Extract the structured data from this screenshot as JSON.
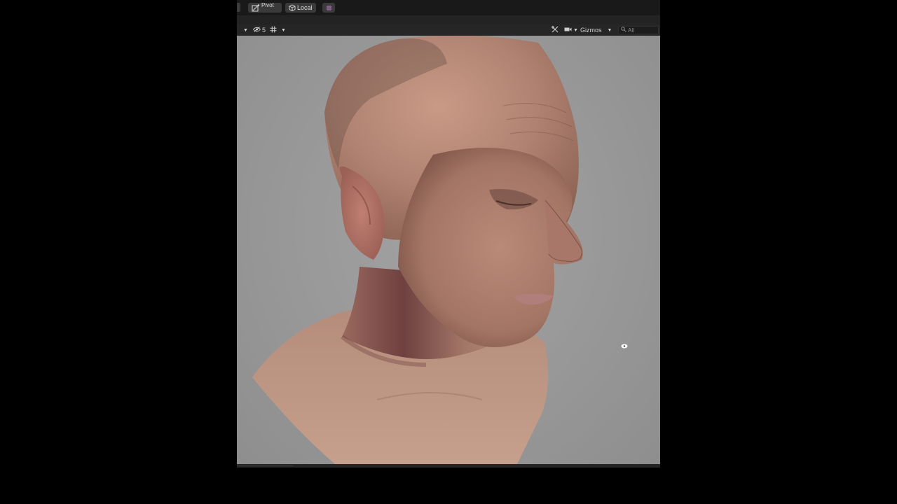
{
  "toolbar": {
    "pivot_label": "Pivot",
    "local_label": "Local"
  },
  "scene_toolbar": {
    "hidden_count": "5",
    "gizmos_label": "Gizmos",
    "search_placeholder": "All"
  },
  "viewport": {
    "subject": "3D scanned head bust model",
    "background_color": "#9a9a9a"
  },
  "icons": [
    "pivot-icon",
    "local-cube-icon",
    "grid-snap-icon",
    "visibility-icon",
    "grid-toggle-icon",
    "tools-icon",
    "camera-icon",
    "search-icon",
    "orientation-marker-icon"
  ]
}
